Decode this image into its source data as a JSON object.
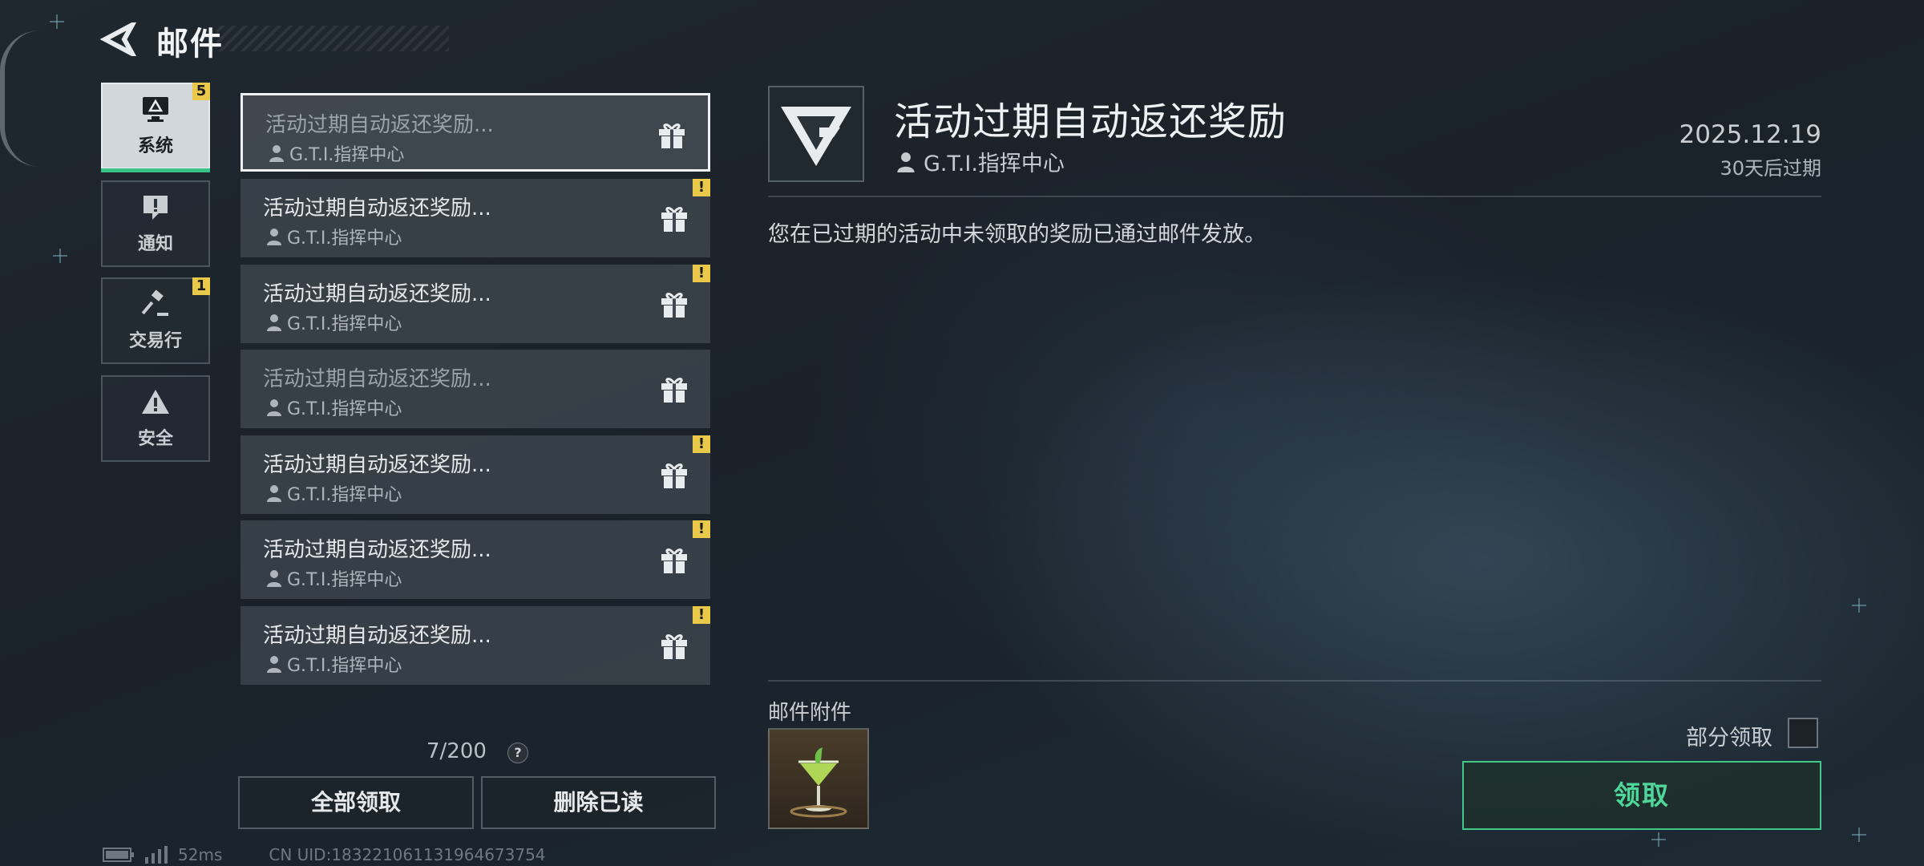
{
  "header": {
    "title": "邮件"
  },
  "categories": [
    {
      "label": "系统",
      "badge": "5",
      "icon": "monitor-icon",
      "active": true
    },
    {
      "label": "通知",
      "badge": "",
      "icon": "alert-bubble-icon",
      "active": false
    },
    {
      "label": "交易行",
      "badge": "1",
      "icon": "gavel-icon",
      "active": false
    },
    {
      "label": "安全",
      "badge": "",
      "icon": "warning-triangle-icon",
      "active": false
    }
  ],
  "mail_list": [
    {
      "title": "活动过期自动返还奖励...",
      "sender": "G.T.I.指挥中心",
      "state": "selected-read",
      "warning": ""
    },
    {
      "title": "活动过期自动返还奖励...",
      "sender": "G.T.I.指挥中心",
      "state": "unread",
      "warning": "!"
    },
    {
      "title": "活动过期自动返还奖励...",
      "sender": "G.T.I.指挥中心",
      "state": "unread",
      "warning": "!"
    },
    {
      "title": "活动过期自动返还奖励...",
      "sender": "G.T.I.指挥中心",
      "state": "read",
      "warning": ""
    },
    {
      "title": "活动过期自动返还奖励...",
      "sender": "G.T.I.指挥中心",
      "state": "unread",
      "warning": "!"
    },
    {
      "title": "活动过期自动返还奖励...",
      "sender": "G.T.I.指挥中心",
      "state": "unread",
      "warning": "!"
    },
    {
      "title": "活动过期自动返还奖励...",
      "sender": "G.T.I.指挥中心",
      "state": "unread",
      "warning": "!"
    }
  ],
  "mail_count": "7/200",
  "help_label": "?",
  "actions": {
    "claim_all": "全部领取",
    "delete_read": "删除已读"
  },
  "status": {
    "ping": "52ms",
    "uid": "CN UID:1832210611319646737​54"
  },
  "detail": {
    "title": "活动过期自动返还奖励",
    "sender": "G.T.I.指挥中心",
    "date": "2025.12.19",
    "expire": "30天后过期",
    "body": "您在已过期的活动中未领取的奖励已通过邮件发放。",
    "attachments_label": "邮件附件",
    "partial_claim_label": "部分领取",
    "claim_label": "领取"
  },
  "colors": {
    "accent_green": "#40c88b",
    "badge_yellow": "#e9c84a"
  }
}
